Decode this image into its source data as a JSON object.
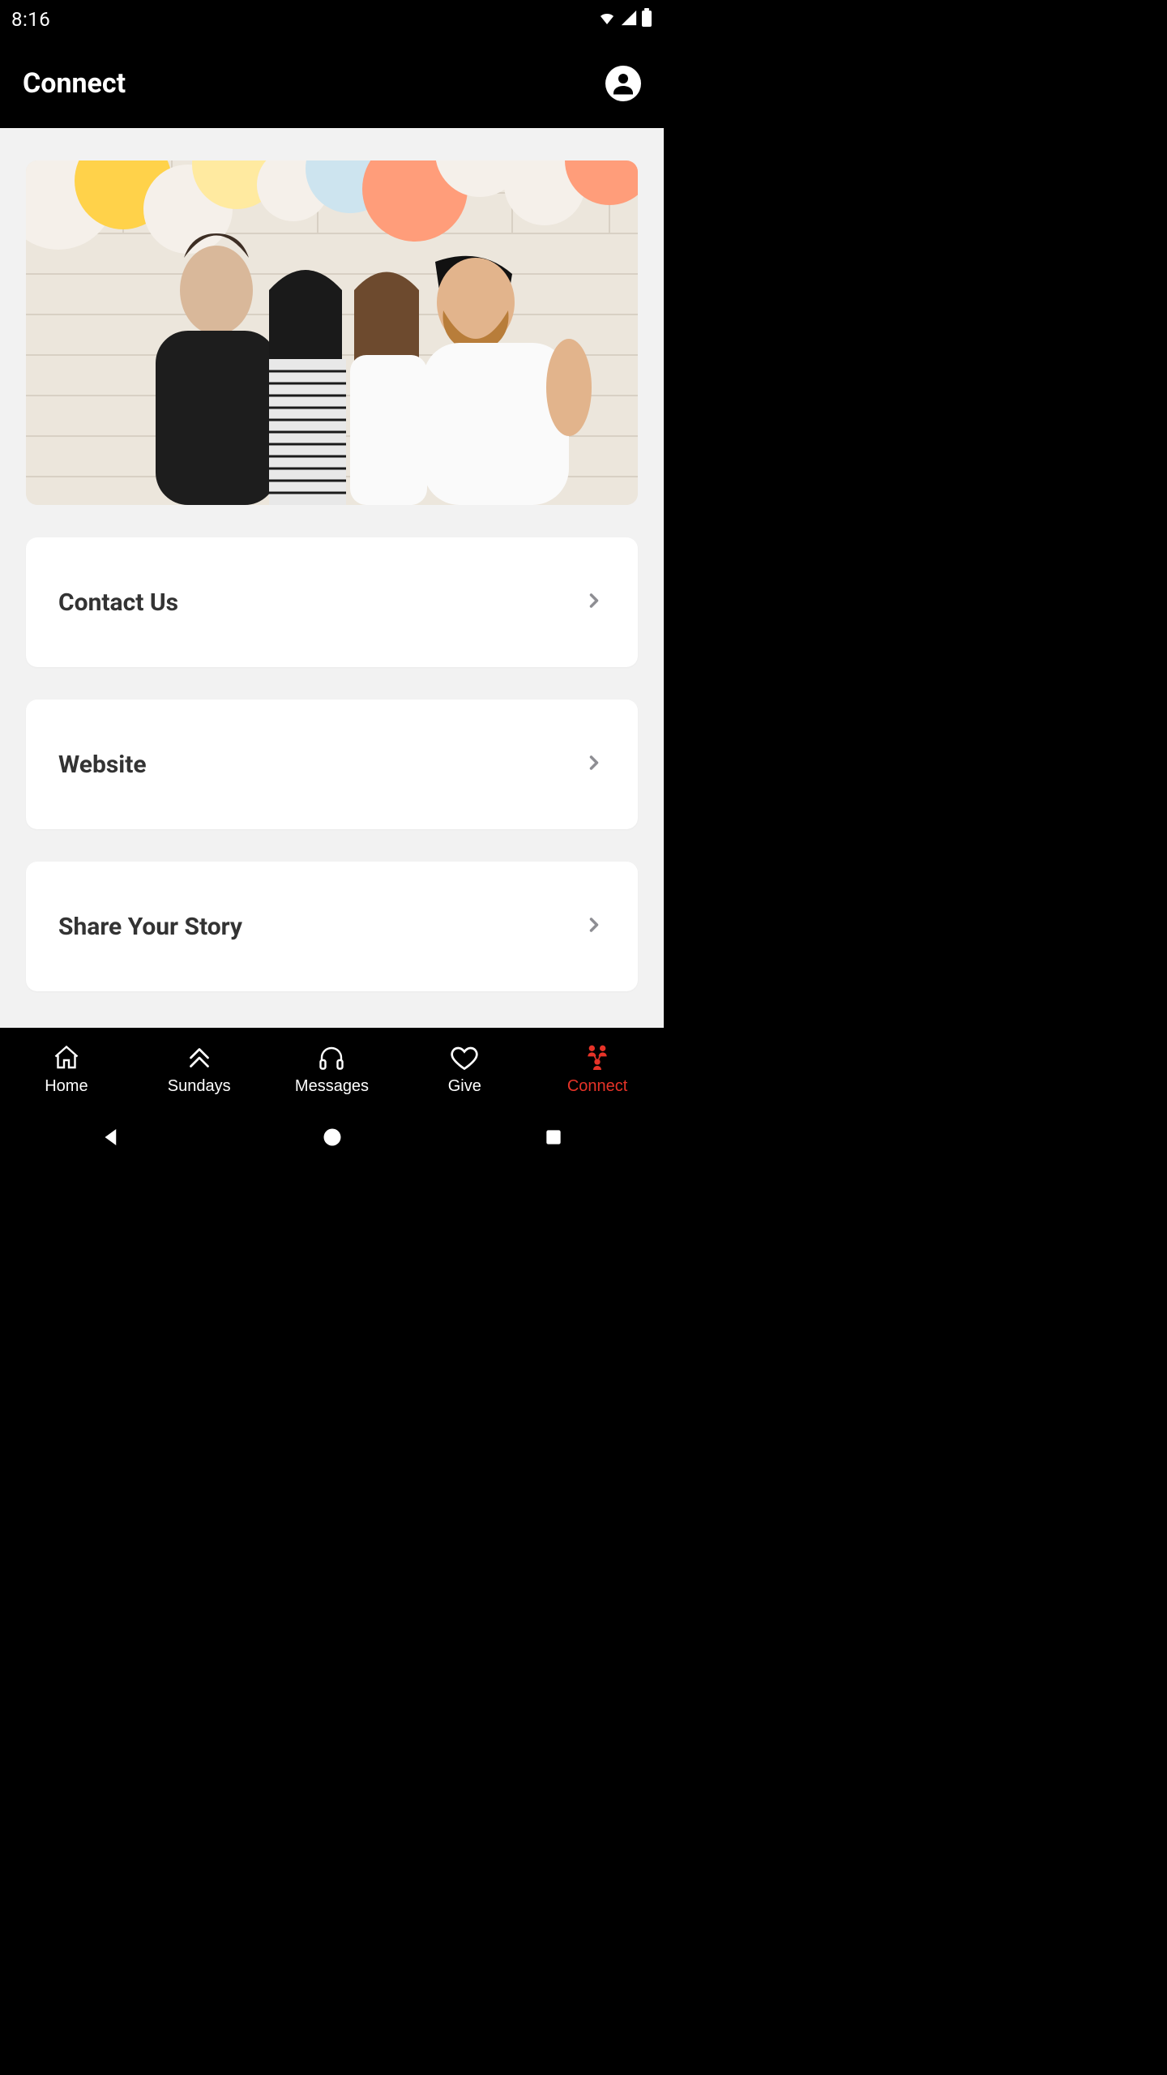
{
  "status": {
    "time": "8:16"
  },
  "header": {
    "title": "Connect"
  },
  "hero": {
    "alt": "Group photo with balloons"
  },
  "menu": {
    "items": [
      {
        "label": "Contact Us"
      },
      {
        "label": "Website"
      },
      {
        "label": "Share Your Story"
      }
    ]
  },
  "tabs": {
    "items": [
      {
        "label": "Home"
      },
      {
        "label": "Sundays"
      },
      {
        "label": "Messages"
      },
      {
        "label": "Give"
      },
      {
        "label": "Connect"
      }
    ],
    "activeIndex": 4
  },
  "colors": {
    "accent": "#e63328"
  }
}
